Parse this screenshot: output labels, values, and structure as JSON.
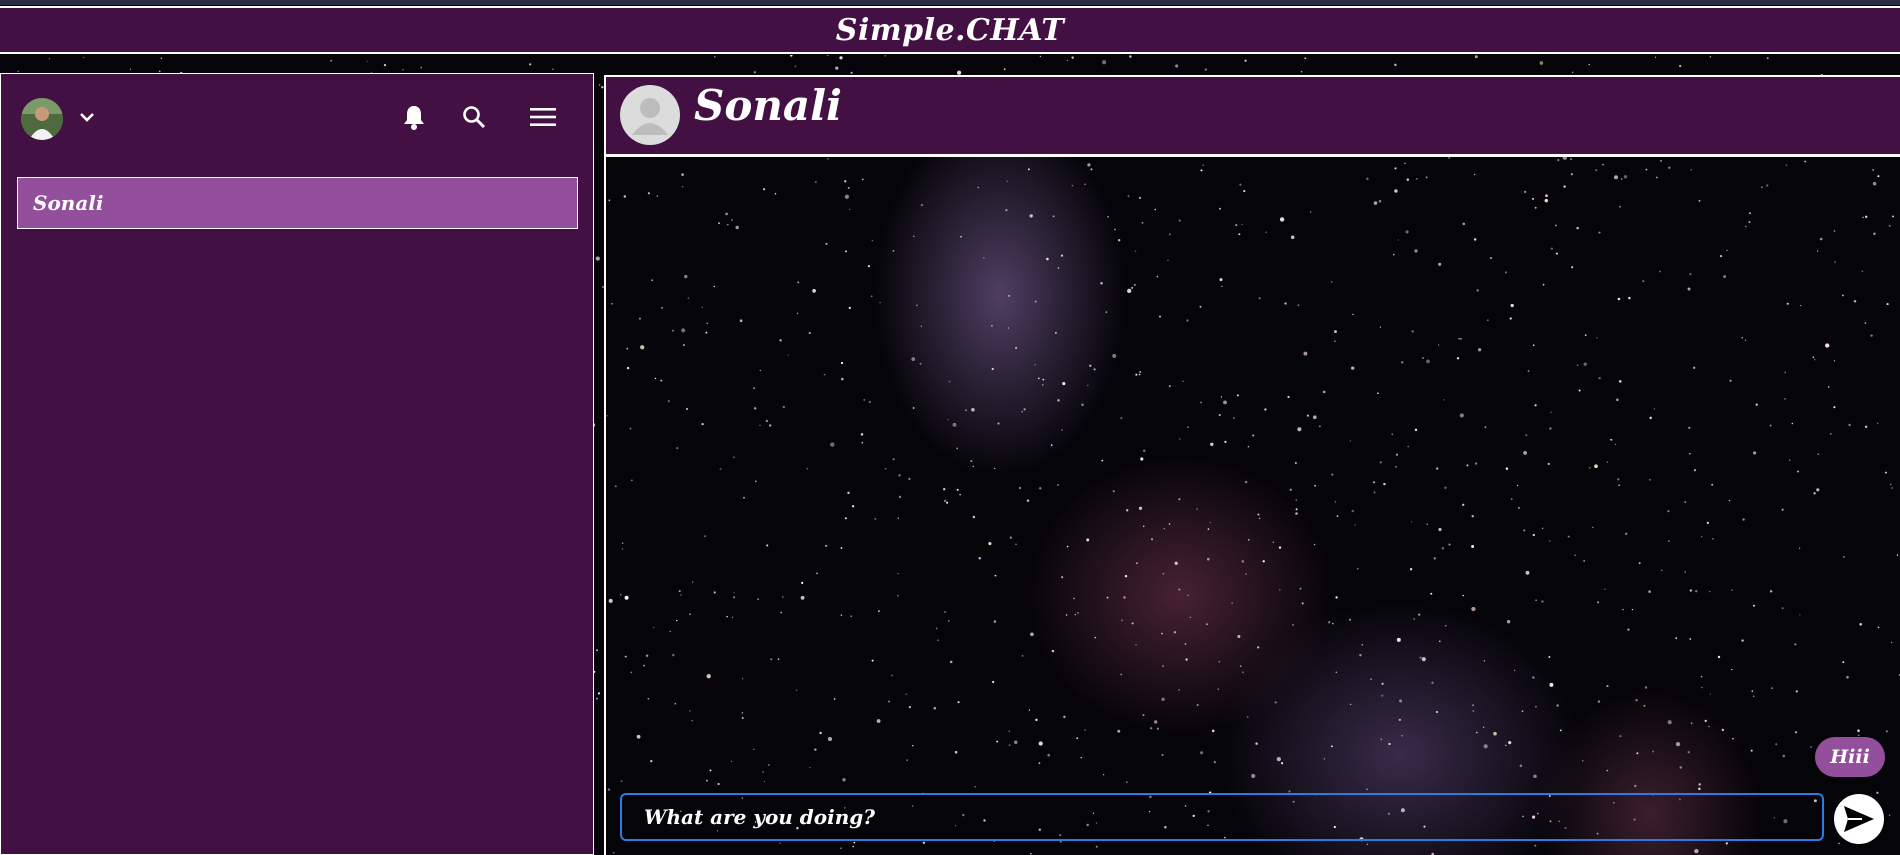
{
  "app": {
    "title": "Simple.CHAT"
  },
  "sidebar": {
    "user_avatar": "user-avatar-photo",
    "icons": [
      "chevron-down-icon",
      "bell-icon",
      "search-icon",
      "menu-icon"
    ],
    "contacts": [
      {
        "label": "Sonali",
        "selected": true
      }
    ]
  },
  "chat": {
    "peer_name": "Sonali",
    "messages": [
      {
        "text": "Hiii",
        "from": "me"
      }
    ],
    "input": {
      "value": "What are you doing?"
    },
    "send_icon": "send-icon"
  },
  "colors": {
    "header_bg": "#421042",
    "selected_item": "#944f9c",
    "input_border": "#2c7be5"
  }
}
